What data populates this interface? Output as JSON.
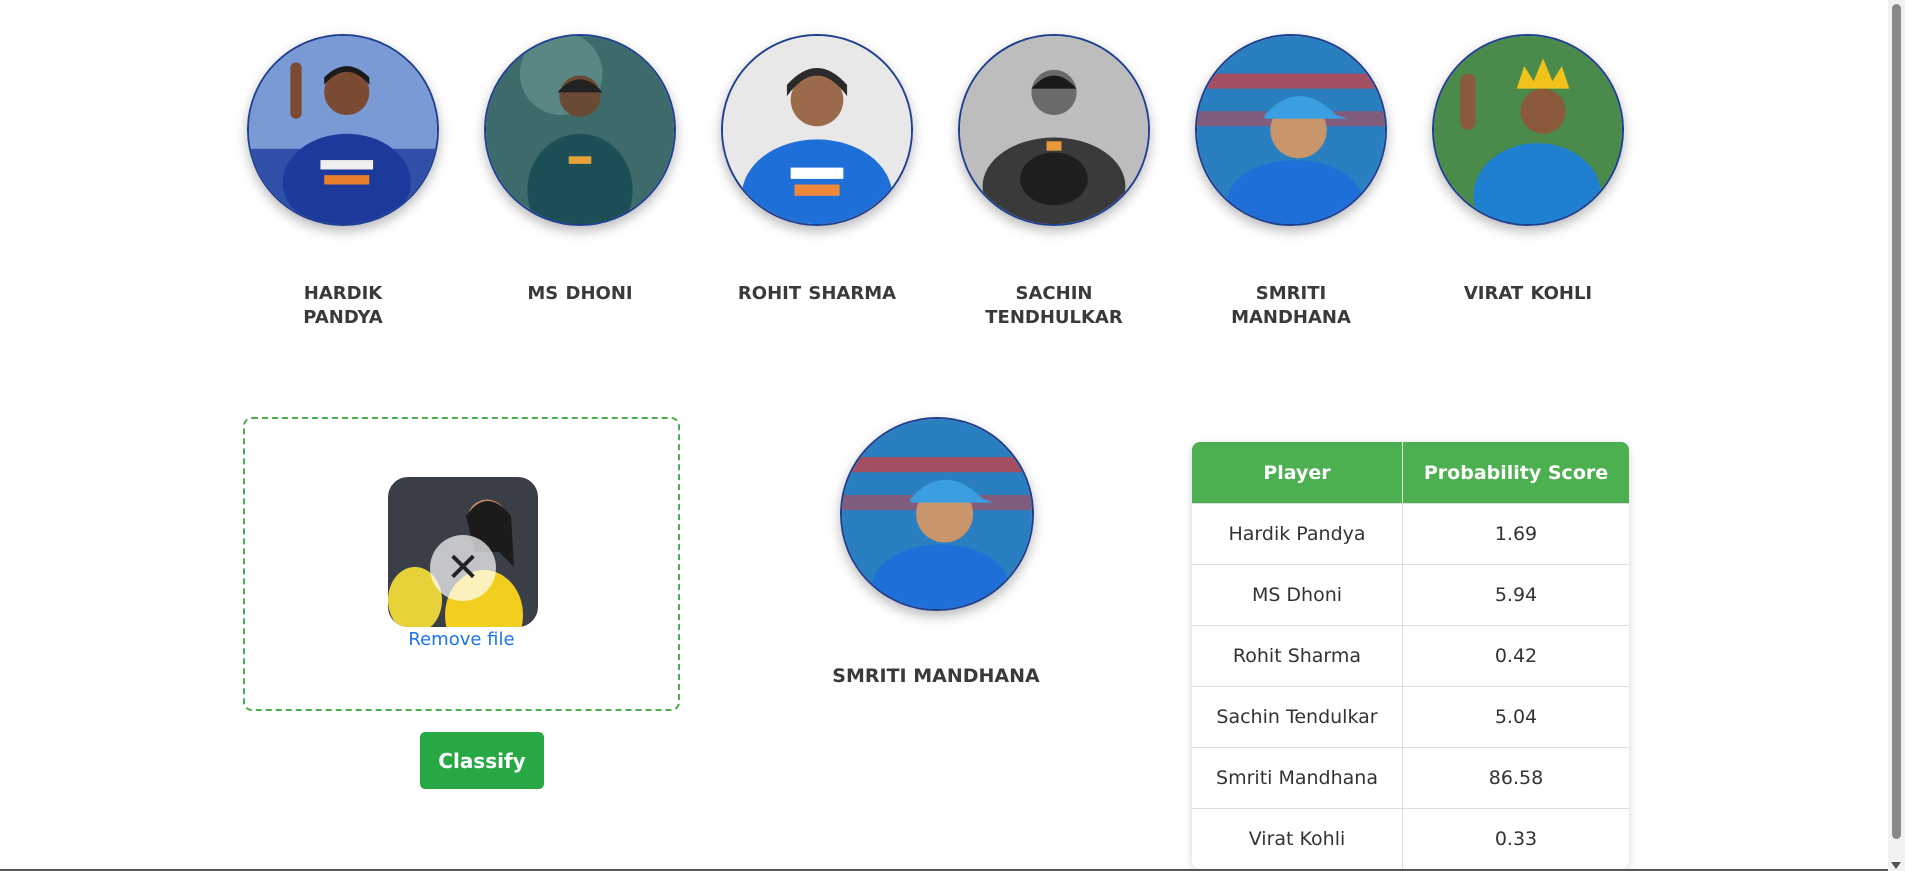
{
  "players": [
    {
      "name": "HARDIK PANDYA",
      "photo": "hardik-pandya-photo"
    },
    {
      "name": "MS DHONI",
      "photo": "ms-dhoni-photo"
    },
    {
      "name": "ROHIT SHARMA",
      "photo": "rohit-sharma-photo"
    },
    {
      "name": "SACHIN TENDHULKAR",
      "photo": "sachin-tendulkar-photo"
    },
    {
      "name": "SMRITI MANDHANA",
      "photo": "smriti-mandhana-photo"
    },
    {
      "name": "VIRAT KOHLI",
      "photo": "virat-kohli-photo"
    }
  ],
  "upload": {
    "remove_label": "Remove file",
    "remove_icon": "close-icon"
  },
  "classify_label": "Classify",
  "result": {
    "name": "SMRITI MANDHANA"
  },
  "table": {
    "headers": [
      "Player",
      "Probability Score"
    ],
    "rows": [
      [
        "Hardik Pandya",
        "1.69"
      ],
      [
        "MS Dhoni",
        "5.94"
      ],
      [
        "Rohit Sharma",
        "0.42"
      ],
      [
        "Sachin Tendulkar",
        "5.04"
      ],
      [
        "Smriti Mandhana",
        "86.58"
      ],
      [
        "Virat Kohli",
        "0.33"
      ]
    ]
  },
  "colors": {
    "accent_green": "#4caf50",
    "button_green": "#28a745",
    "link_blue": "#1a74e8",
    "avatar_border": "#1f3f8f"
  }
}
